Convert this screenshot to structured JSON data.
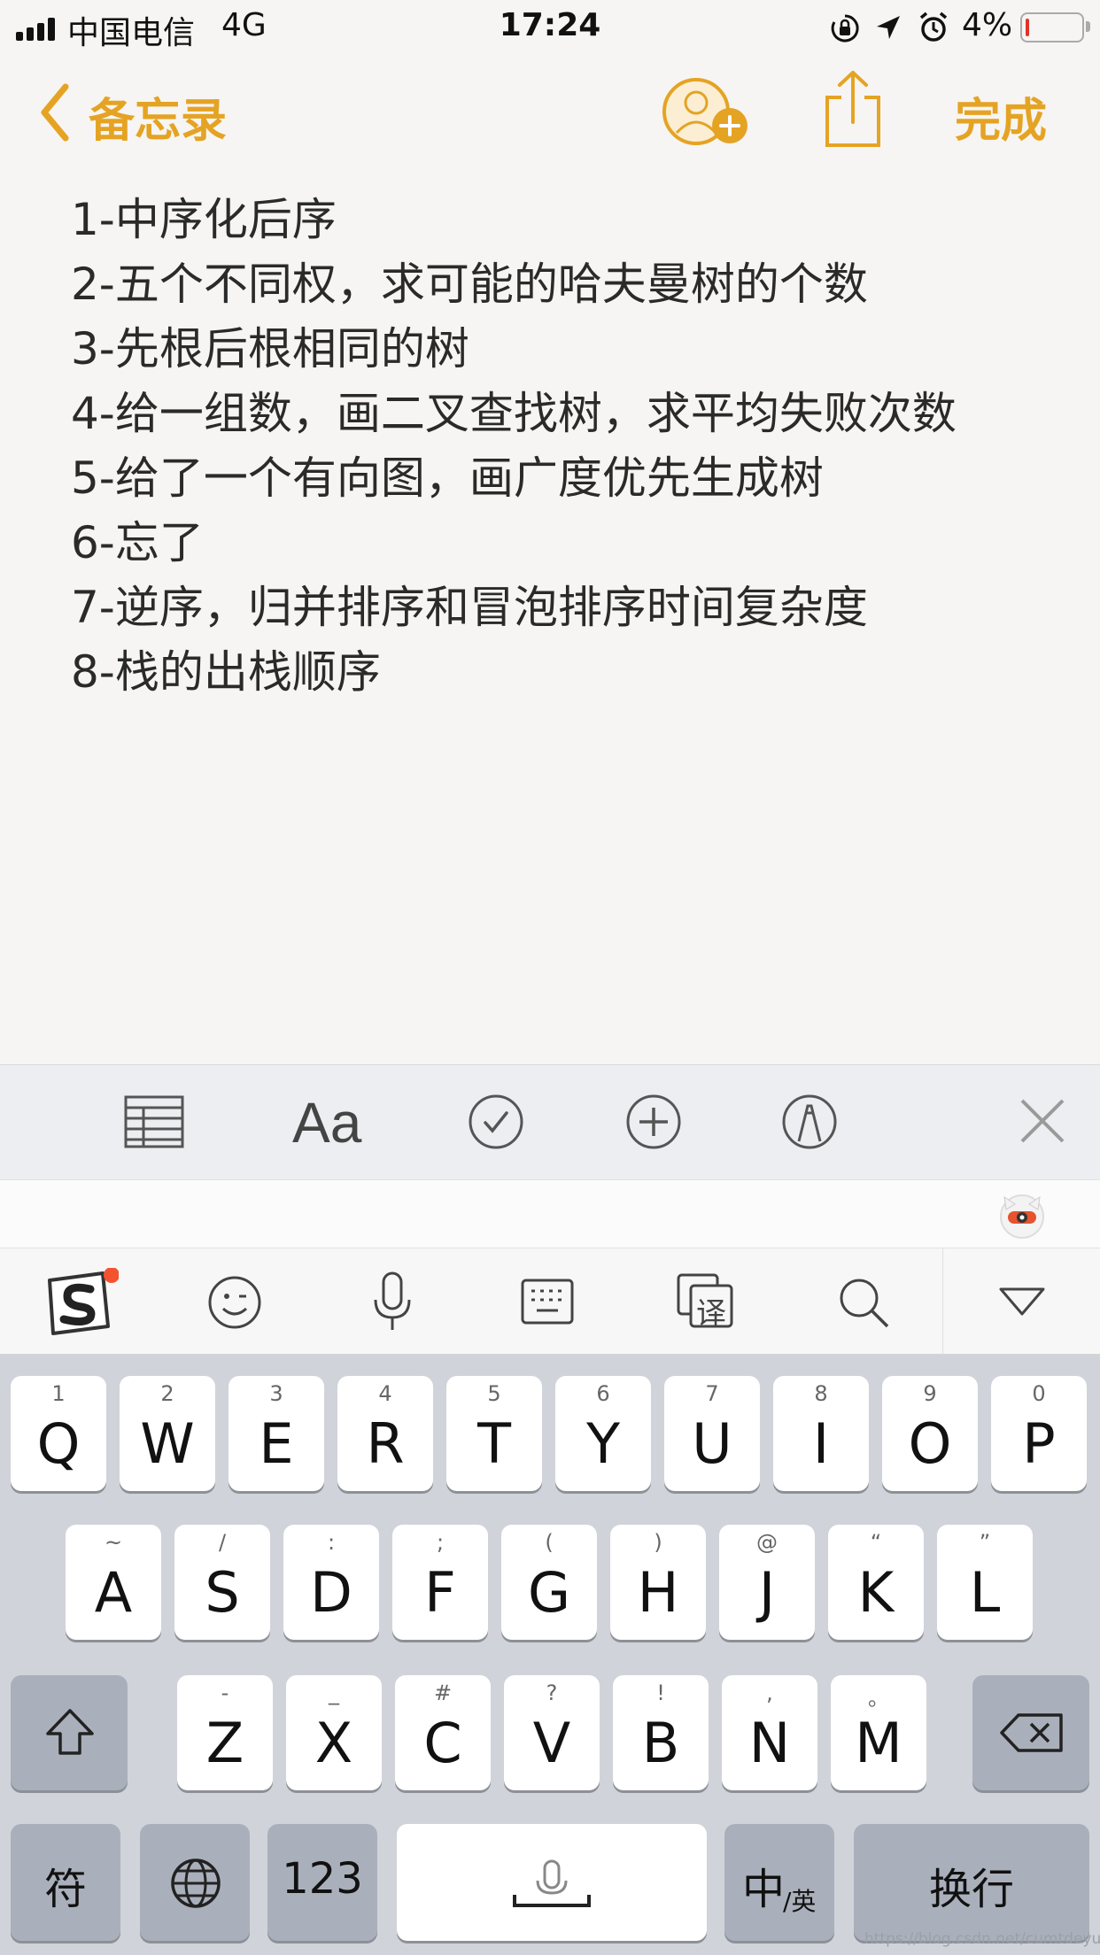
{
  "status_bar": {
    "carrier": "中国电信",
    "network": "4G",
    "time": "17:24",
    "battery_percent": "4%"
  },
  "nav": {
    "back_label": "备忘录",
    "done_label": "完成",
    "accent_color": "#e5a324"
  },
  "note": {
    "lines": [
      "1-中序化后序",
      "2-五个不同权，求可能的哈夫曼树的个数",
      "3-先根后根相同的树",
      "4-给一组数，画二叉查找树，求平均失败次数",
      "5-给了一个有向图，画广度优先生成树",
      "6-忘了",
      "7-逆序，归并排序和冒泡排序时间复杂度",
      "8-栈的出栈顺序"
    ]
  },
  "format_toolbar": {
    "text_style_label": "Aa",
    "icons": [
      "table-icon",
      "text-style-icon",
      "checklist-icon",
      "add-icon",
      "markup-icon",
      "close-icon"
    ]
  },
  "ime_toolbar": {
    "icons": [
      "sogou-logo-icon",
      "emoji-icon",
      "microphone-icon",
      "keyboard-icon",
      "translate-icon",
      "search-icon",
      "collapse-icon"
    ],
    "translate_char": "译"
  },
  "keyboard": {
    "row1": [
      {
        "key": "Q",
        "sub": "1"
      },
      {
        "key": "W",
        "sub": "2"
      },
      {
        "key": "E",
        "sub": "3"
      },
      {
        "key": "R",
        "sub": "4"
      },
      {
        "key": "T",
        "sub": "5"
      },
      {
        "key": "Y",
        "sub": "6"
      },
      {
        "key": "U",
        "sub": "7"
      },
      {
        "key": "I",
        "sub": "8"
      },
      {
        "key": "O",
        "sub": "9"
      },
      {
        "key": "P",
        "sub": "0"
      }
    ],
    "row2": [
      {
        "key": "A",
        "sub": "~"
      },
      {
        "key": "S",
        "sub": "/"
      },
      {
        "key": "D",
        "sub": ":"
      },
      {
        "key": "F",
        "sub": ";"
      },
      {
        "key": "G",
        "sub": "("
      },
      {
        "key": "H",
        "sub": ")"
      },
      {
        "key": "J",
        "sub": "@"
      },
      {
        "key": "K",
        "sub": "“"
      },
      {
        "key": "L",
        "sub": "”"
      }
    ],
    "row3": [
      {
        "key": "Z",
        "sub": "-"
      },
      {
        "key": "X",
        "sub": "_"
      },
      {
        "key": "C",
        "sub": "#"
      },
      {
        "key": "V",
        "sub": "?"
      },
      {
        "key": "B",
        "sub": "!"
      },
      {
        "key": "N",
        "sub": ","
      },
      {
        "key": "M",
        "sub": "。"
      }
    ],
    "symbols_label": "符",
    "numbers_label": "123",
    "lang_main": "中",
    "lang_sub": "/英",
    "return_label": "换行"
  },
  "watermark": "https://blog.csdn.net/cumtdeyurenjia"
}
